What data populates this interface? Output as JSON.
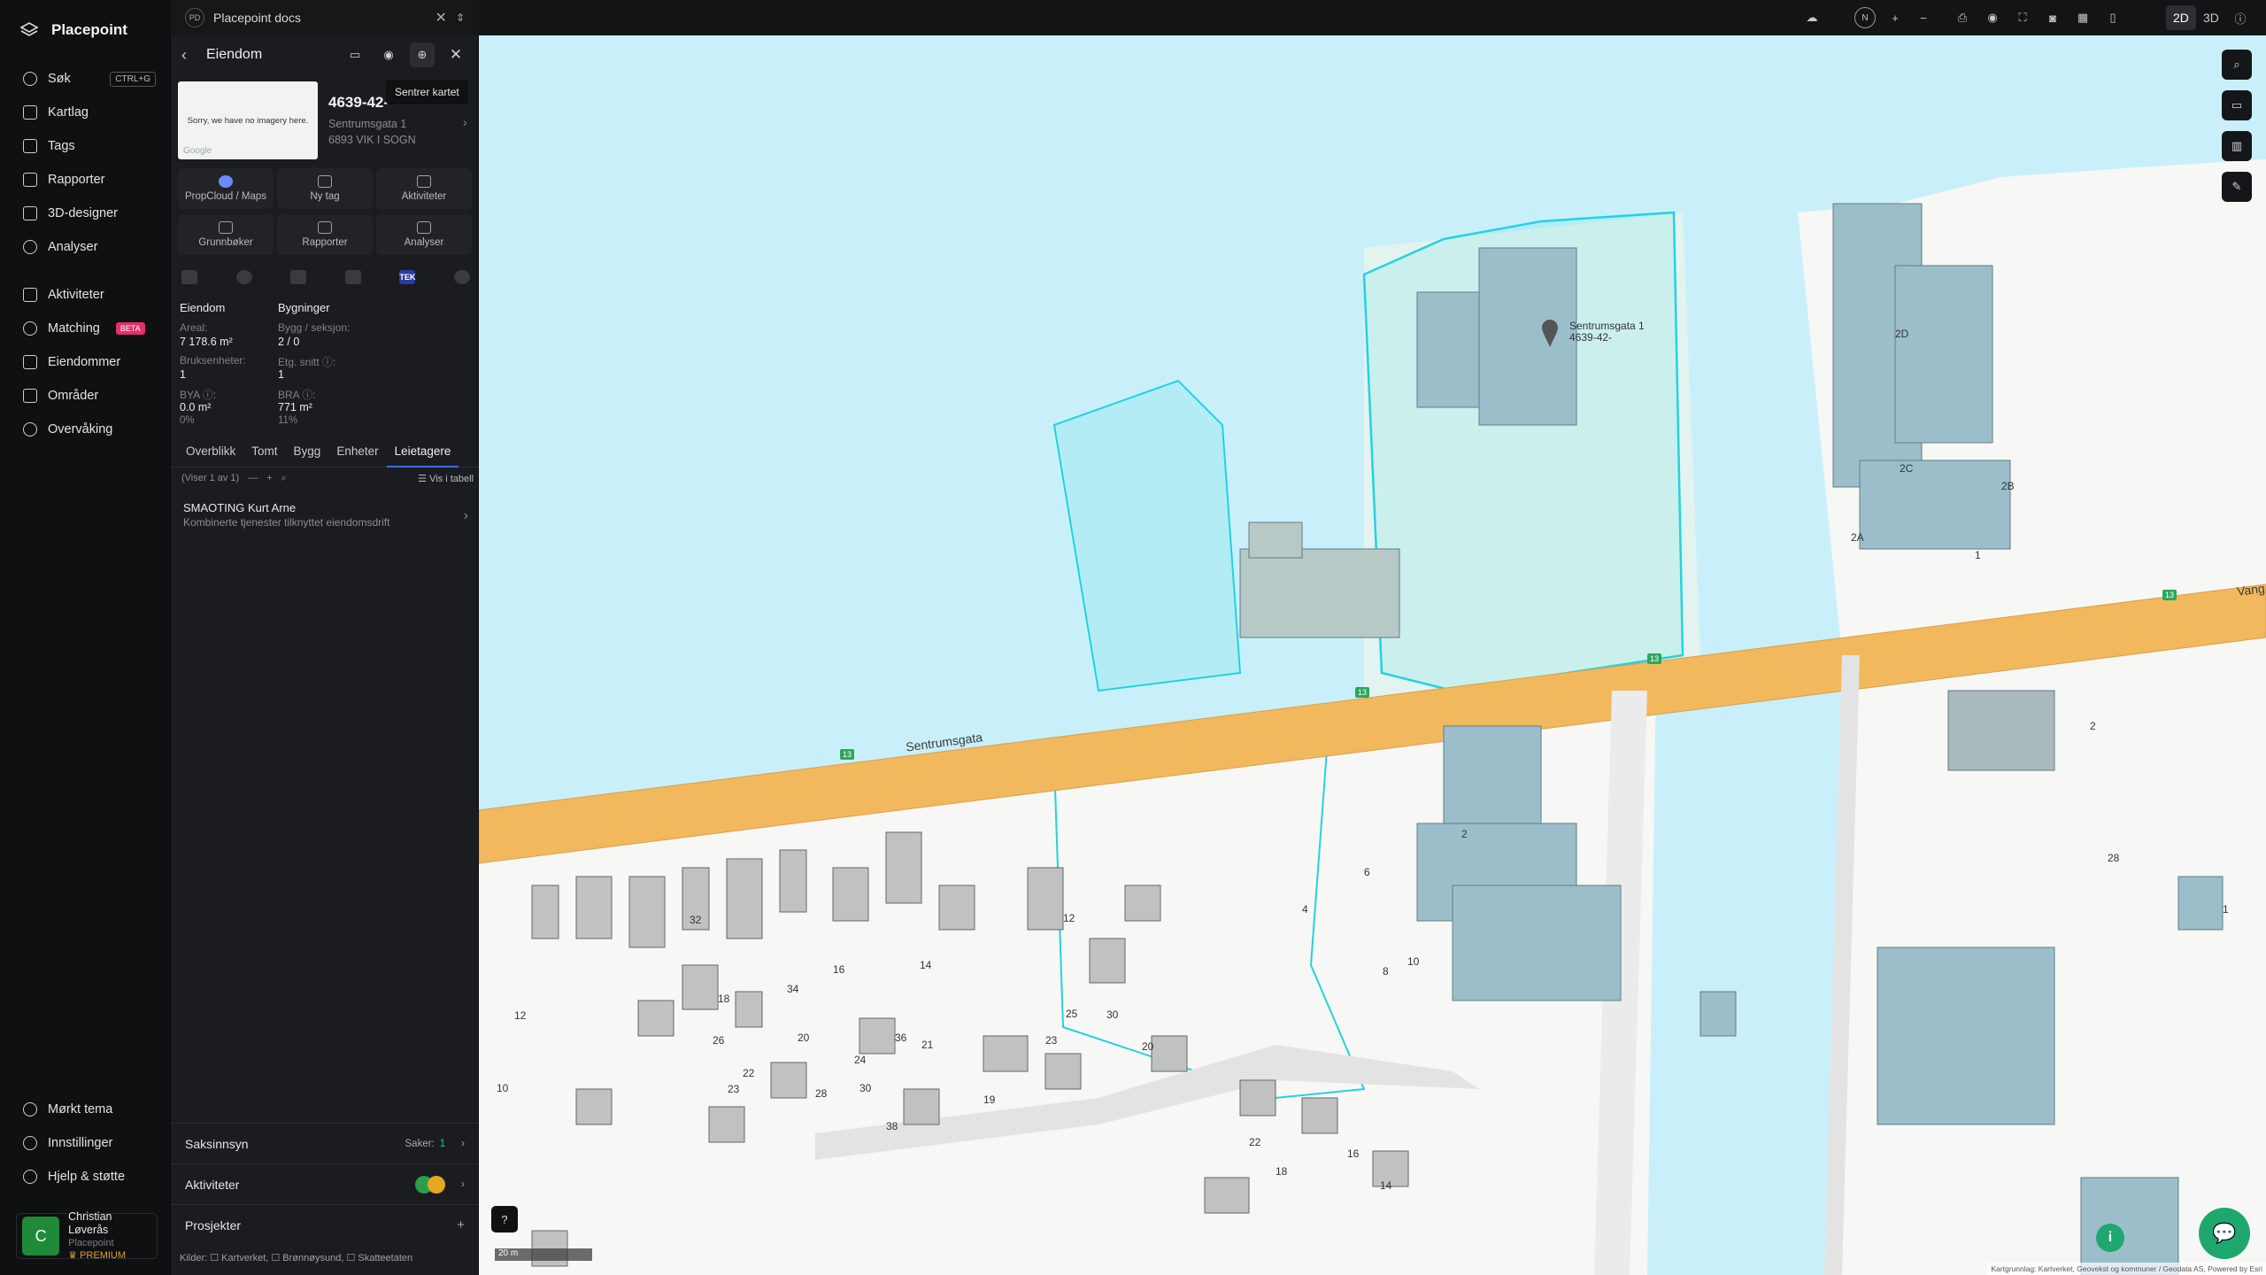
{
  "brand": "Placepoint",
  "nav": {
    "items": [
      {
        "label": "Søk",
        "shortcut": "CTRL+G"
      },
      {
        "label": "Kartlag"
      },
      {
        "label": "Tags"
      },
      {
        "label": "Rapporter"
      },
      {
        "label": "3D-designer"
      },
      {
        "label": "Analyser"
      },
      {
        "label": "Aktiviteter"
      },
      {
        "label": "Matching",
        "badge": "BETA"
      },
      {
        "label": "Eiendommer"
      },
      {
        "label": "Områder"
      },
      {
        "label": "Overvåking"
      }
    ],
    "bottom": [
      {
        "label": "Mørkt tema"
      },
      {
        "label": "Innstillinger"
      },
      {
        "label": "Hjelp & støtte"
      }
    ],
    "user": {
      "initial": "C",
      "name": "Christian Løverås",
      "org": "Placepoint",
      "plan": "PREMIUM"
    }
  },
  "panel": {
    "doc_badge": "PD",
    "doc_title": "Placepoint docs",
    "title": "Eiendom",
    "tooltip": "Sentrer kartet",
    "thumb_text": "Sorry, we have no imagery here.",
    "thumb_google": "Google",
    "prop_id": "4639-42-",
    "address_line1": "Sentrumsgata 1",
    "address_line2": "6893 VIK I SOGN",
    "actions": [
      {
        "label": "PropCloud / Maps"
      },
      {
        "label": "Ny tag"
      },
      {
        "label": "Aktiviteter"
      },
      {
        "label": "Grunnbøker"
      },
      {
        "label": "Rapporter"
      },
      {
        "label": "Analyser"
      }
    ],
    "tek_label": "TEK",
    "info": {
      "eiendom_heading": "Eiendom",
      "bygninger_heading": "Bygninger",
      "areal_label": "Areal:",
      "areal_value": "7 178.6 m²",
      "bygg_label": "Bygg / seksjon:",
      "bygg_value": "2 / 0",
      "bruksenheter_label": "Bruksenheter:",
      "bruksenheter_value": "1",
      "etg_label": "Etg. snitt ⓘ:",
      "etg_value": "1",
      "bya_label": "BYA ⓘ:",
      "bya_value": "0.0 m²",
      "bya_pct": "0%",
      "bra_label": "BRA ⓘ:",
      "bra_value": "771 m²",
      "bra_pct": "11%"
    },
    "tabs": [
      "Overblikk",
      "Tomt",
      "Bygg",
      "Enheter",
      "Leietagere"
    ],
    "list_count": "(Viser 1 av 1)",
    "list_table": "Vis i tabell",
    "tenant_name": "SMAOTING Kurt Arne",
    "tenant_desc": "Kombinerte tjenester tilknyttet eiendomsdrift",
    "saksinnsyn": "Saksinnsyn",
    "saker_label": "Saker:",
    "saker_count": "1",
    "aktiviteter": "Aktiviteter",
    "prosjekter": "Prosjekter",
    "sources": "Kilder: ☐ Kartverket, ☐ Brønnøysund, ☐ Skatteetaten"
  },
  "topbar": {
    "compass": "N",
    "mode_2d": "2D",
    "mode_3d": "3D"
  },
  "map": {
    "street_main": "Sentrumsgata",
    "street_right": "Vang",
    "marker_label": "Sentrumsgata 1",
    "marker_sub": "4639-42-",
    "scale": "20 m",
    "attribution": "Kartgrunnlag: Kartverket, Geovekst og kommuner / Geodata AS, Powered by Esri",
    "building_numbers": [
      "2D",
      "2C",
      "2B",
      "2A",
      "2",
      "1",
      "2",
      "4",
      "6",
      "10",
      "8",
      "12",
      "14",
      "16",
      "18",
      "20",
      "22",
      "23",
      "24",
      "26",
      "28",
      "30",
      "32",
      "34",
      "36",
      "38",
      "19",
      "21",
      "23",
      "25",
      "30",
      "22",
      "20",
      "18",
      "16",
      "14",
      "12",
      "10",
      "28",
      "26",
      "24",
      "1"
    ],
    "road_number": "13",
    "colors": {
      "water": "#c9f0fa",
      "road": "#f2b85e",
      "building": "#9cbecb",
      "parcel": "#22d3e0"
    }
  }
}
